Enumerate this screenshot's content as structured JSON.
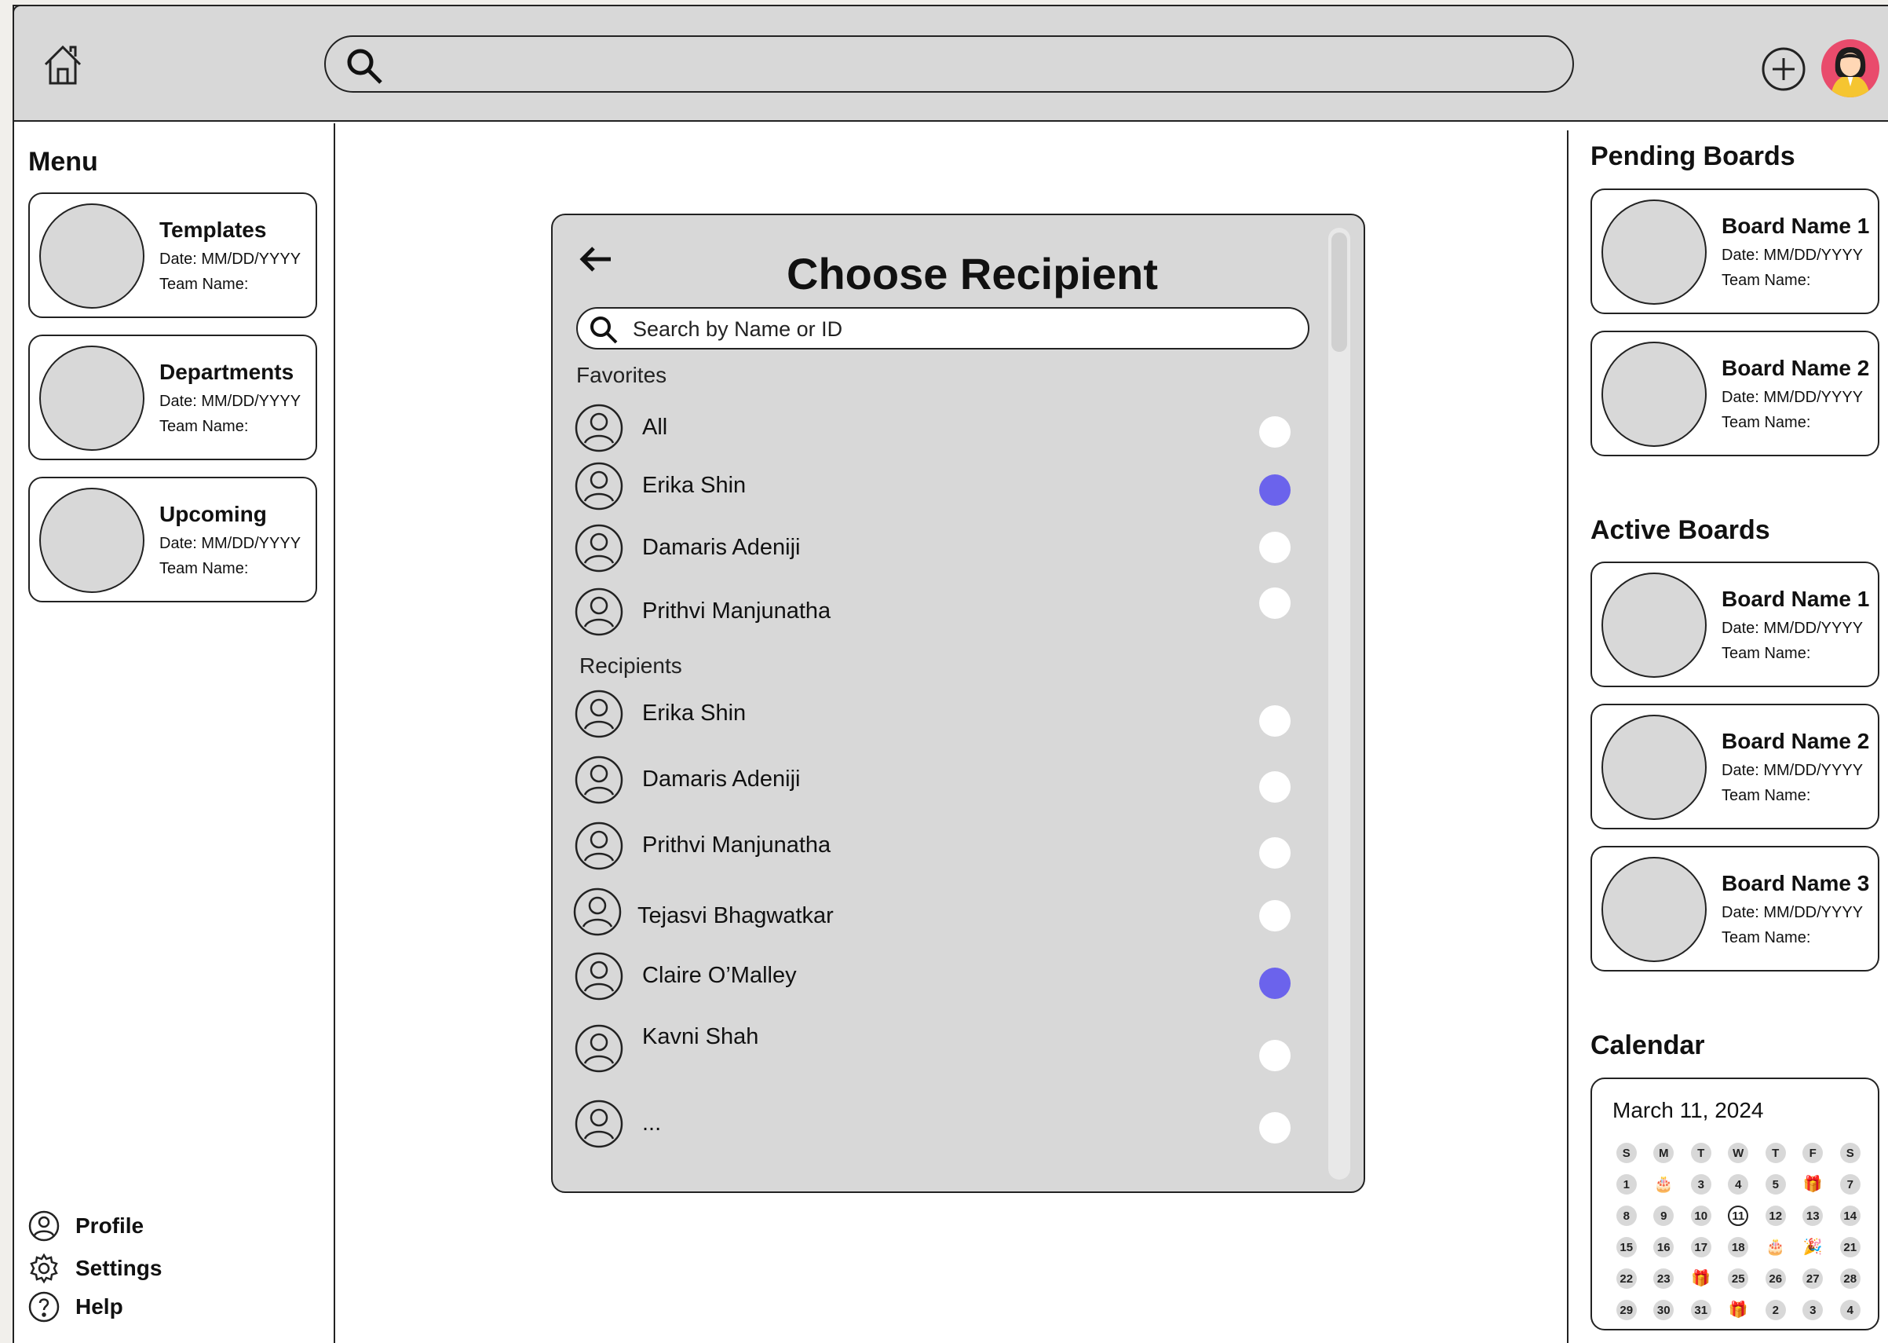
{
  "left_menu": {
    "title": "Menu",
    "cards": [
      {
        "title": "Templates",
        "date": "Date: MM/DD/YYYY",
        "team": "Team Name:"
      },
      {
        "title": "Departments",
        "date": "Date: MM/DD/YYYY",
        "team": "Team Name:"
      },
      {
        "title": "Upcoming",
        "date": "Date: MM/DD/YYYY",
        "team": "Team Name:"
      }
    ],
    "bottom_links": [
      "Profile",
      "Settings",
      "Help"
    ]
  },
  "dialog": {
    "title": "Choose Recipient",
    "search_placeholder": "Search by Name or ID",
    "favorites_label": "Favorites",
    "favorites": [
      {
        "name": "All",
        "selected": false
      },
      {
        "name": "Erika Shin",
        "selected": true
      },
      {
        "name": "Damaris Adeniji",
        "selected": false
      },
      {
        "name": "Prithvi Manjunatha",
        "selected": false
      }
    ],
    "recipients_label": "Recipients",
    "recipients": [
      {
        "name": "Erika Shin",
        "selected": false
      },
      {
        "name": "Damaris Adeniji",
        "selected": false
      },
      {
        "name": "Prithvi Manjunatha",
        "selected": false
      },
      {
        "name": "Tejasvi Bhagwatkar",
        "selected": false
      },
      {
        "name": "Claire O’Malley",
        "selected": true
      },
      {
        "name": "Kavni Shah",
        "selected": false
      },
      {
        "name": "...",
        "selected": false
      }
    ],
    "selected_color": "#6b63ec"
  },
  "pending": {
    "title": "Pending Boards",
    "cards": [
      {
        "title": "Board Name 1",
        "date": "Date: MM/DD/YYYY",
        "team": "Team Name:"
      },
      {
        "title": "Board Name 2",
        "date": "Date: MM/DD/YYYY",
        "team": "Team Name:"
      }
    ]
  },
  "active": {
    "title": "Active Boards",
    "cards": [
      {
        "title": "Board Name 1",
        "date": "Date: MM/DD/YYYY",
        "team": "Team Name:"
      },
      {
        "title": "Board Name 2",
        "date": "Date: MM/DD/YYYY",
        "team": "Team Name:"
      },
      {
        "title": "Board Name 3",
        "date": "Date: MM/DD/YYYY",
        "team": "Team Name:"
      }
    ]
  },
  "calendar": {
    "title": "Calendar",
    "month_label": "March 11, 2024",
    "weekdays": [
      "S",
      "M",
      "T",
      "W",
      "T",
      "F",
      "S"
    ],
    "weeks": [
      [
        "1",
        "cake",
        "3",
        "4",
        "5",
        "gift",
        "7"
      ],
      [
        "8",
        "9",
        "10",
        "11",
        "12",
        "13",
        "14"
      ],
      [
        "15",
        "16",
        "17",
        "18",
        "cake",
        "party",
        "21"
      ],
      [
        "22",
        "23",
        "gift",
        "25",
        "26",
        "27",
        "28"
      ],
      [
        "29",
        "30",
        "31",
        "gift",
        "2",
        "3",
        "4"
      ]
    ],
    "today": "11"
  },
  "colors": {
    "header_bg": "#d8d8d8",
    "avatar_bg": "#e94b6c"
  }
}
